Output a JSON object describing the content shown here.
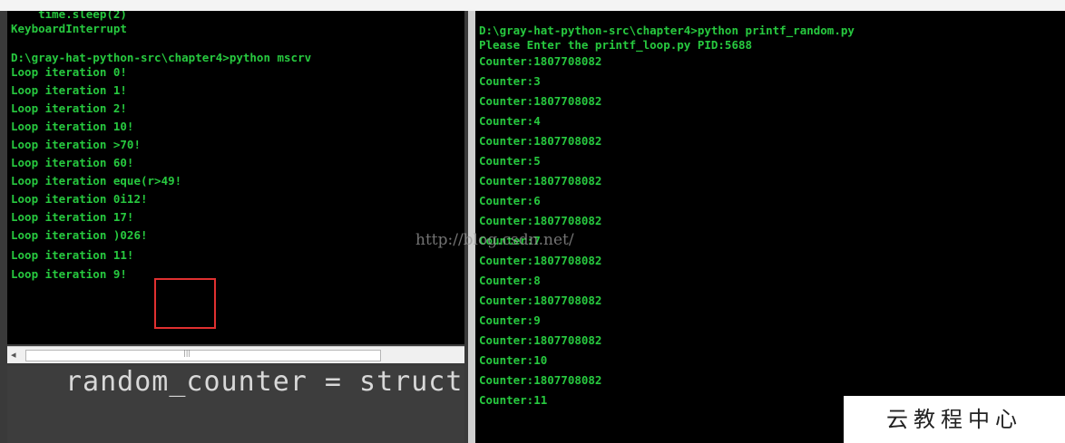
{
  "top_strip": {
    "faded_text": ""
  },
  "left_console": {
    "lines": [
      "    time.sleep(2)",
      "KeyboardInterrupt",
      "",
      "D:\\gray-hat-python-src\\chapter4>python mscrv",
      "Loop iteration 0!",
      "Loop iteration 1!",
      "Loop iteration 2!",
      "Loop iteration 10!",
      "Loop iteration >70!",
      "Loop iteration 60!",
      "Loop iteration eque(r>49!",
      "Loop iteration 0i12!",
      "Loop iteration 17!",
      "Loop iteration )026!",
      "Loop iteration 11!",
      "Loop iteration 9!"
    ],
    "scroll_left_arrow": "◂",
    "scroll_grip": "|||"
  },
  "editor_strip": {
    "code": "random_counter = struct."
  },
  "right_console": {
    "lines": [
      "D:\\gray-hat-python-src\\chapter4>python printf_random.py",
      "Please Enter the printf_loop.py PID:5688",
      "Counter:1807708082",
      "Counter:3",
      "Counter:1807708082",
      "Counter:4",
      "Counter:1807708082",
      "Counter:5",
      "Counter:1807708082",
      "Counter:6",
      "Counter:1807708082",
      "Counter:7",
      "Counter:1807708082",
      "Counter:8",
      "Counter:1807708082",
      "Counter:9",
      "Counter:1807708082",
      "Counter:10",
      "Counter:1807708082",
      "Counter:11"
    ]
  },
  "watermark": "http://blog.csdn.net/",
  "brand_badge": "云教程中心",
  "colors": {
    "console_text": "#27c93f",
    "console_bg": "#000000",
    "highlight": "#e03030"
  }
}
